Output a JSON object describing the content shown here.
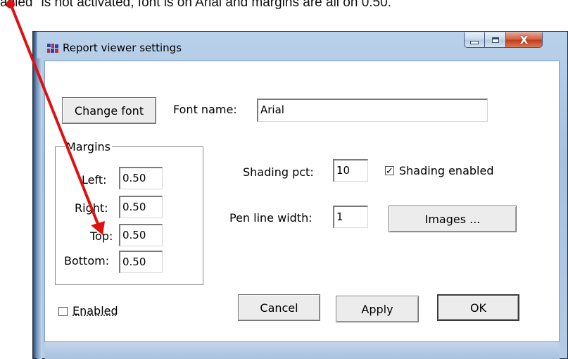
{
  "caption": "abled\" is not activated, font is on Arial and margins are all on 0.50.",
  "window": {
    "title": "Report viewer settings",
    "controls": {
      "minimize_icon": "minimize-icon",
      "maximize_icon": "maximize-icon",
      "close_glyph": "X"
    }
  },
  "font": {
    "change_font_label": "Change font",
    "font_name_label": "Font name:",
    "font_name_value": "Arial"
  },
  "margins": {
    "group_title": "Margins",
    "left_label": "Left:",
    "left_value": "0.50",
    "right_label": "Right:",
    "right_value": "0.50",
    "top_label": "Top:",
    "top_value": "0.50",
    "bottom_label": "Bottom:",
    "bottom_value": "0.50"
  },
  "shading": {
    "pct_label": "Shading pct:",
    "pct_value": "10",
    "enabled_label": "Shading enabled",
    "enabled_checked": true
  },
  "pen": {
    "label": "Pen line width:",
    "value": "1"
  },
  "images_button": "Images ...",
  "enabled": {
    "label": "Enabled",
    "checked": false
  },
  "buttons": {
    "cancel": "Cancel",
    "apply": "Apply",
    "ok": "OK"
  },
  "annotation": {
    "arrow_color": "#e01010"
  }
}
